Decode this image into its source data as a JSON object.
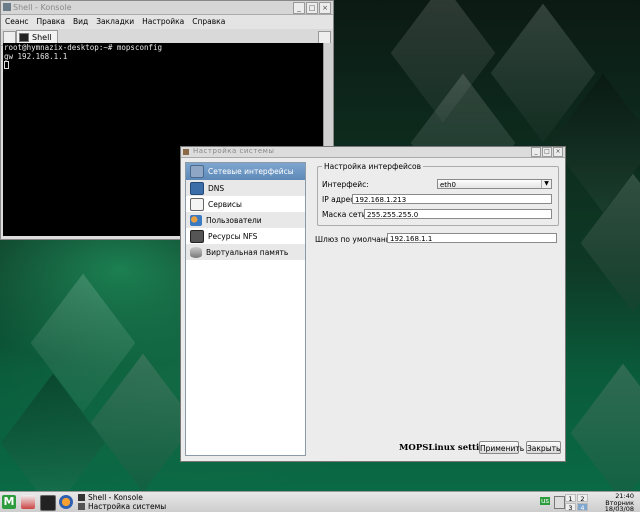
{
  "konsole": {
    "title": "Shell - Konsole",
    "menu": [
      "Сеанс",
      "Правка",
      "Вид",
      "Закладки",
      "Настройка",
      "Справка"
    ],
    "tab_label": "Shell",
    "terminal_lines": [
      "root@hymnazix-desktop:~# mopsconfig",
      "gw 192.168.1.1"
    ]
  },
  "dialog": {
    "title": "Настройка системы",
    "sidebar": [
      {
        "label": "Сетевые интерфейсы",
        "icon": "network-card-icon",
        "selected": true
      },
      {
        "label": "DNS",
        "icon": "monitor-icon"
      },
      {
        "label": "Сервисы",
        "icon": "services-icon"
      },
      {
        "label": "Пользователи",
        "icon": "users-icon"
      },
      {
        "label": "Ресурсы NFS",
        "icon": "nfs-share-icon"
      },
      {
        "label": "Виртуальная память",
        "icon": "disk-icon"
      }
    ],
    "group_title": "Настройка интерфейсов",
    "interface_label": "Интерфейс:",
    "interface_value": "eth0",
    "ip_label": "IP адрес:",
    "ip_value": "192.168.1.213",
    "mask_label": "Маска сети:",
    "mask_value": "255.255.255.0",
    "gateway_label": "Шлюз по умолчанию:",
    "gateway_value": "192.168.1.1",
    "brand": "MOPSLinux settings",
    "apply_label": "Применить",
    "close_label": "Закрыть"
  },
  "taskbar": {
    "tasks": [
      "Shell - Konsole",
      "Настройка системы"
    ],
    "tray_badge": "us",
    "pager": [
      "1",
      "2",
      "3",
      "4"
    ],
    "clock_time": "21:40",
    "clock_day": "Вторник",
    "clock_date": "18/03/08"
  },
  "colors": {
    "accent": "#5e89b8",
    "desktop_green": "#0a6a45",
    "terminal_bg": "#000000"
  }
}
